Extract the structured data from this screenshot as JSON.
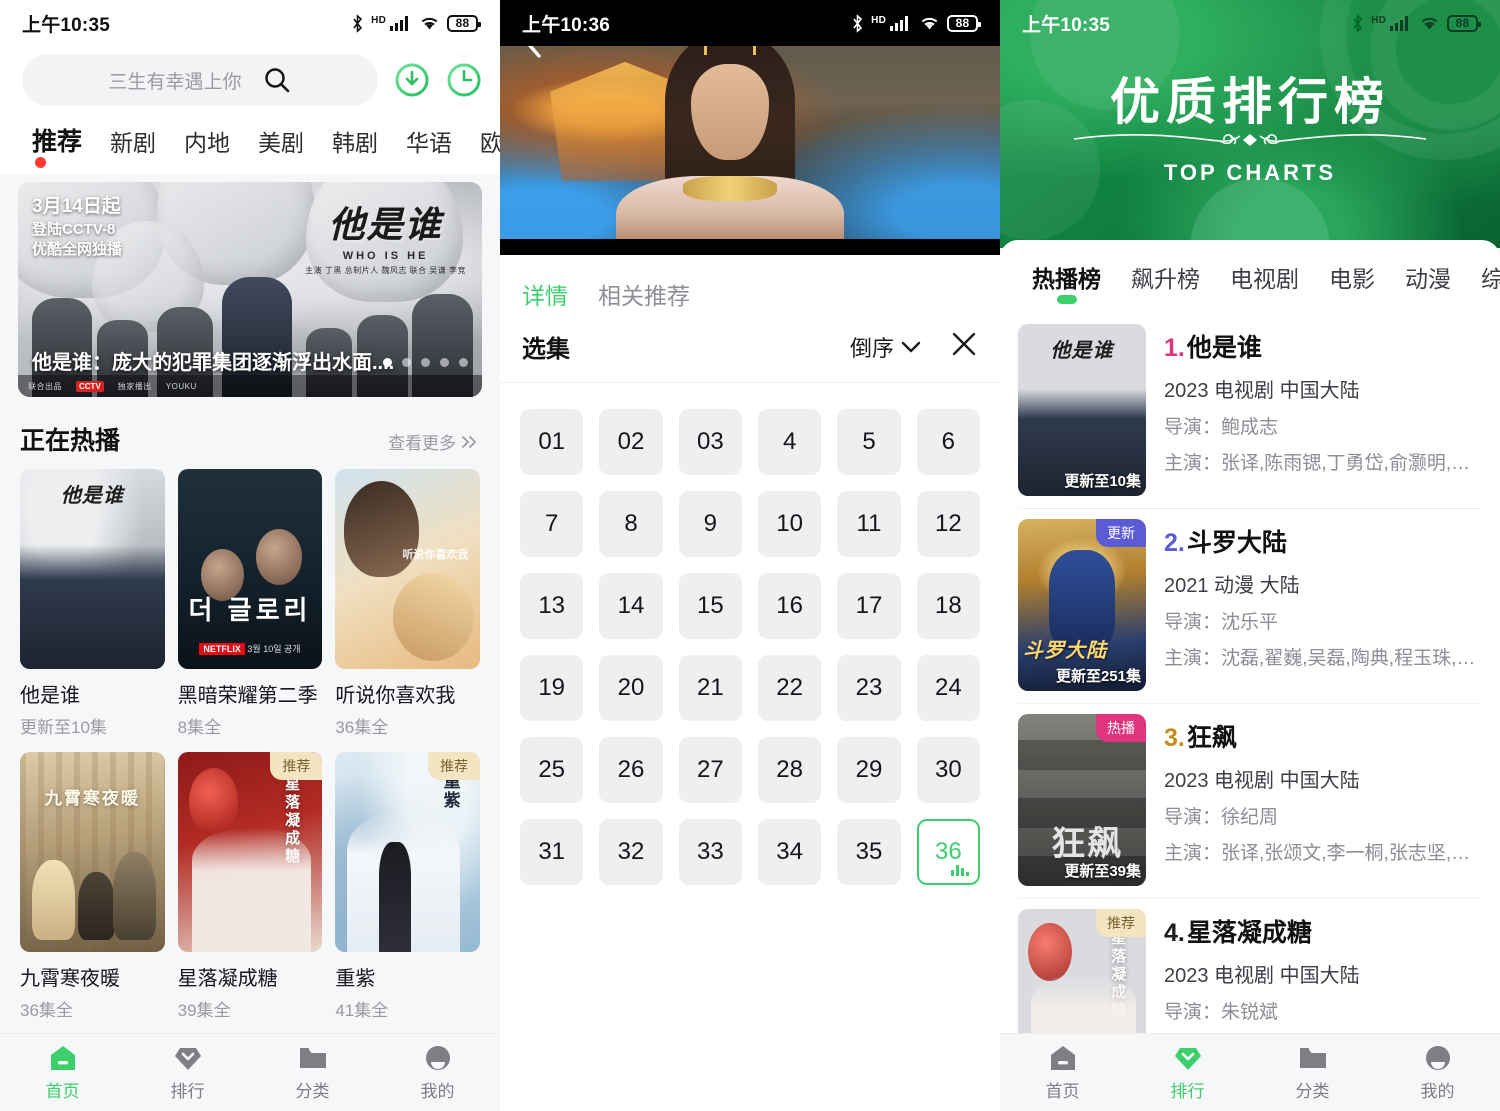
{
  "statusbar": {
    "time_home": "上午10:35",
    "time_player": "上午10:36",
    "time_rank": "上午10:35",
    "battery": "88",
    "hd": "HD"
  },
  "home": {
    "search": {
      "placeholder": "三生有幸遇上你",
      "search_icon": "search-icon"
    },
    "actions": [
      {
        "name": "download-icon",
        "label": "下载"
      },
      {
        "name": "history-icon",
        "label": "历史"
      }
    ],
    "tabs": [
      {
        "label": "推荐",
        "active": true
      },
      {
        "label": "新剧",
        "active": false
      },
      {
        "label": "内地",
        "active": false
      },
      {
        "label": "美剧",
        "active": false
      },
      {
        "label": "韩剧",
        "active": false
      },
      {
        "label": "华语",
        "active": false
      },
      {
        "label": "欧",
        "active": false
      }
    ],
    "banner": {
      "date_line1": "3月14日起",
      "date_line2": "登陆CCTV-8",
      "date_line3": "优酷全网独播",
      "logo_cn": "他是谁",
      "logo_en": "WHO IS HE",
      "logo_cast": "主演 丁黑  总制片人 魏风志  联合 吴谦 李竞",
      "caption": "他是谁：庞大的犯罪集团逐渐浮出水面....",
      "dots_total": 5,
      "dots_active": 0,
      "footer_left": "联合出品",
      "footer_red": "CCTV",
      "footer_mid": "独家播出",
      "footer_right": "YOUKU"
    },
    "section": {
      "title": "正在热播",
      "more": "查看更多",
      "more_icon": "chevron-double-right-icon"
    },
    "cards": [
      {
        "title": "他是谁",
        "sub": "更新至10集",
        "badge": "",
        "art": "art-whoishe"
      },
      {
        "title": "黑暗荣耀第二季",
        "sub": "8集全",
        "badge": "",
        "art": "art-glory"
      },
      {
        "title": "听说你喜欢我",
        "sub": "36集全",
        "badge": "",
        "art": "art-hear"
      },
      {
        "title": "九霄寒夜暖",
        "sub": "36集全",
        "badge": "",
        "art": "art-jiuxiao"
      },
      {
        "title": "星落凝成糖",
        "sub": "39集全",
        "badge": "推荐",
        "art": "art-xingluo"
      },
      {
        "title": "重紫",
        "sub": "41集全",
        "badge": "推荐",
        "art": "art-chongzi"
      }
    ],
    "poster_art_text": {
      "whoishe_title": "他是谁",
      "glory_title": "더 글로리",
      "glory_netflix": "NETFLIX",
      "glory_date": "3월 10일 공개",
      "hear_title": "听说你喜欢我",
      "jiuxiao_title": "九霄寒夜暖",
      "xingluo_title": "星落凝成糖",
      "chongzi_title": "重紫"
    },
    "nav": [
      {
        "label": "首页",
        "icon": "home-icon",
        "active": true
      },
      {
        "label": "排行",
        "icon": "diamond-icon",
        "active": false
      },
      {
        "label": "分类",
        "icon": "folder-icon",
        "active": false
      },
      {
        "label": "我的",
        "icon": "user-icon",
        "active": false
      }
    ]
  },
  "player": {
    "back_icon": "back-chevron-icon",
    "tabs": [
      {
        "label": "详情",
        "active": true
      },
      {
        "label": "相关推荐",
        "active": false
      }
    ],
    "episode_panel": {
      "title": "选集",
      "sort_label": "倒序",
      "sort_icon": "chevron-down-icon",
      "close_icon": "close-icon",
      "selected": "36",
      "episodes": [
        "01",
        "02",
        "03",
        "4",
        "5",
        "6",
        "7",
        "8",
        "9",
        "10",
        "11",
        "12",
        "13",
        "14",
        "15",
        "16",
        "17",
        "18",
        "19",
        "20",
        "21",
        "22",
        "23",
        "24",
        "25",
        "26",
        "27",
        "28",
        "29",
        "30",
        "31",
        "32",
        "33",
        "34",
        "35",
        "36"
      ]
    }
  },
  "rank": {
    "hero": {
      "title": "优质排行榜",
      "subtitle": "TOP CHARTS"
    },
    "tabs": [
      {
        "label": "热播榜",
        "active": true
      },
      {
        "label": "飙升榜",
        "active": false
      },
      {
        "label": "电视剧",
        "active": false
      },
      {
        "label": "电影",
        "active": false
      },
      {
        "label": "动漫",
        "active": false
      },
      {
        "label": "综艺",
        "active": false
      }
    ],
    "items": [
      {
        "rank": "1.",
        "title": "他是谁",
        "meta": "2023  电视剧  中国大陆",
        "director": "导演：鲍成志",
        "cast": "主演：张译,陈雨锶,丁勇岱,俞灏明,赵阳",
        "episode_overlay": "更新至10集",
        "badge": "",
        "badge_type": "",
        "art": "art-whoishe"
      },
      {
        "rank": "2.",
        "title": "斗罗大陆",
        "meta": "2021  动漫  大陆",
        "director": "导演：沈乐平",
        "cast": "主演：沈磊,翟巍,吴磊,陶典,程玉珠,黄翔宇",
        "episode_overlay": "更新至251集",
        "badge": "更新",
        "badge_type": "upd",
        "art": "art-douluo"
      },
      {
        "rank": "3.",
        "title": "狂飙",
        "meta": "2023  电视剧  中国大陆",
        "director": "导演：徐纪周",
        "cast": "主演：张译,张颂文,李一桐,张志坚,吴刚",
        "episode_overlay": "更新至39集",
        "badge": "热播",
        "badge_type": "hot",
        "art": "art-kuangbiao"
      },
      {
        "rank": "4.",
        "title": "星落凝成糖",
        "meta": "2023  电视剧  中国大陆",
        "director": "导演：朱锐斌",
        "cast": "",
        "episode_overlay": "",
        "badge": "推荐",
        "badge_type": "rec",
        "art": "art-xingluo"
      }
    ],
    "nav": [
      {
        "label": "首页",
        "icon": "home-icon",
        "active": false
      },
      {
        "label": "排行",
        "icon": "diamond-icon",
        "active": true
      },
      {
        "label": "分类",
        "icon": "folder-icon",
        "active": false
      },
      {
        "label": "我的",
        "icon": "user-icon",
        "active": false
      }
    ]
  },
  "colors": {
    "accent_green": "#3ecf6d",
    "hero_green": "#0f7d3e",
    "badge_update": "#5b5bd6",
    "badge_hot": "#e0347f",
    "badge_rec": "#f3e4c2"
  }
}
